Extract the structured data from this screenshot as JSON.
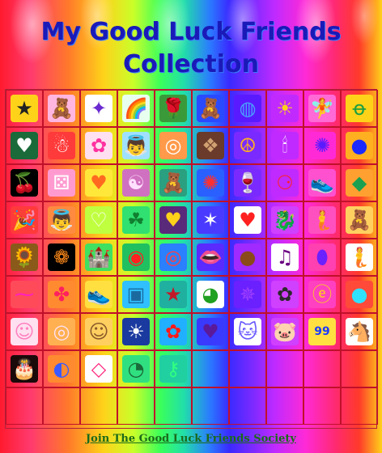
{
  "page": {
    "title": "My Good Luck Friends Collection",
    "footer_link": "Join The Good Luck Friends Society"
  },
  "colors": {
    "title": "#1a1ab8",
    "grid_border": "#c0102a",
    "footer_link": "#1a6a1a"
  },
  "grid": {
    "columns": 10,
    "rows": [
      [
        {
          "icon": "star-medal-icon",
          "glyph": "★",
          "bg": "#ffd21a",
          "fg": "#222"
        },
        {
          "icon": "pink-bear-icon",
          "glyph": "🧸",
          "bg": "#ffb6e0",
          "fg": "#c04090"
        },
        {
          "icon": "compass-icon",
          "glyph": "✦",
          "bg": "#ffffff",
          "fg": "#6a2ad0"
        },
        {
          "icon": "rainbow-icon",
          "glyph": "🌈",
          "bg": "#e8fff0",
          "fg": "#ff3030"
        },
        {
          "icon": "rose-icon",
          "glyph": "🌹",
          "bg": "#3a9a3a",
          "fg": "#ff2020"
        },
        {
          "icon": "teddy-bear-icon",
          "glyph": "🧸",
          "bg": "#2a4aff",
          "fg": "#c08020"
        },
        {
          "icon": "globe-icon",
          "glyph": "◍",
          "bg": "#5a1aff",
          "fg": "#4aa0ff"
        },
        {
          "icon": "sun-icon",
          "glyph": "☀",
          "bg": "#c02aff",
          "fg": "#ffd21a"
        },
        {
          "icon": "fairy-icon",
          "glyph": "🧚",
          "bg": "#ff6ad6",
          "fg": "#20a060"
        },
        {
          "icon": "ribbon-icon",
          "glyph": "ꝋ",
          "bg": "#ffd21a",
          "fg": "#20a040"
        }
      ],
      [
        {
          "icon": "heart-frame-icon",
          "glyph": "♥",
          "bg": "#1a6a3a",
          "fg": "#ffffff"
        },
        {
          "icon": "snowman-icon",
          "glyph": "☃",
          "bg": "#ff3a3a",
          "fg": "#ffffff"
        },
        {
          "icon": "troll-doll-icon",
          "glyph": "✿",
          "bg": "#ffe0f0",
          "fg": "#ff30a0"
        },
        {
          "icon": "angel-fairy-icon",
          "glyph": "👼",
          "bg": "#a0e0ff",
          "fg": "#ffb060"
        },
        {
          "icon": "dreamcatcher-icon",
          "glyph": "◎",
          "bg": "#ff9a4a",
          "fg": "#ffffff"
        },
        {
          "icon": "celtic-knot-icon",
          "glyph": "❖",
          "bg": "#6a3a2a",
          "fg": "#d0a070"
        },
        {
          "icon": "peace-sign-icon",
          "glyph": "☮",
          "bg": "#7a2aff",
          "fg": "#ffb020"
        },
        {
          "icon": "candle-icon",
          "glyph": "🕯",
          "bg": "#c02aff",
          "fg": "#ffffff"
        },
        {
          "icon": "purple-sun-icon",
          "glyph": "✺",
          "bg": "#ff2ad6",
          "fg": "#5a1aff"
        },
        {
          "icon": "blue-orb-icon",
          "glyph": "●",
          "bg": "#ffb020",
          "fg": "#1a2aff"
        }
      ],
      [
        {
          "icon": "cherries-icon",
          "glyph": "🍒",
          "bg": "#000000",
          "fg": "#ff2020"
        },
        {
          "icon": "dice-icon",
          "glyph": "⚄",
          "bg": "#ff9ad0",
          "fg": "#ffffff"
        },
        {
          "icon": "rainbow-heart-icon",
          "glyph": "♥",
          "bg": "#ffe83a",
          "fg": "#ff6a20"
        },
        {
          "icon": "yin-yang-icon",
          "glyph": "☯",
          "bg": "#d070c0",
          "fg": "#ffe0ff"
        },
        {
          "icon": "brown-bear-icon",
          "glyph": "🧸",
          "bg": "#2aa080",
          "fg": "#8a5a2a"
        },
        {
          "icon": "swirl-icon",
          "glyph": "✺",
          "bg": "#2a60ff",
          "fg": "#ff3030"
        },
        {
          "icon": "wine-glass-icon",
          "glyph": "🍷",
          "bg": "#7a2aff",
          "fg": "#ff2020"
        },
        {
          "icon": "gumball-machine-icon",
          "glyph": "⚆",
          "bg": "#c02aff",
          "fg": "#ff2020"
        },
        {
          "icon": "sneaker-icon",
          "glyph": "👟",
          "bg": "#ff50d0",
          "fg": "#ffffff"
        },
        {
          "icon": "green-gem-icon",
          "glyph": "◆",
          "bg": "#ffa030",
          "fg": "#1aa050"
        }
      ],
      [
        {
          "icon": "party-hat-icon",
          "glyph": "🎉",
          "bg": "#ff3a3a",
          "fg": "#ffd21a"
        },
        {
          "icon": "angel-icon",
          "glyph": "👼",
          "bg": "#ff8a40",
          "fg": "#8ac0ff"
        },
        {
          "icon": "outline-heart-icon",
          "glyph": "♡",
          "bg": "#c0ff40",
          "fg": "#ffffff"
        },
        {
          "icon": "four-leaf-clover-icon",
          "glyph": "☘",
          "bg": "#30e070",
          "fg": "#108030"
        },
        {
          "icon": "gold-heart-icon",
          "glyph": "♥",
          "bg": "#5a2a7a",
          "fg": "#ffd21a"
        },
        {
          "icon": "purple-swirl-icon",
          "glyph": "✶",
          "bg": "#4a3aff",
          "fg": "#ffffff"
        },
        {
          "icon": "dancing-heart-icon",
          "glyph": "♥",
          "bg": "#ffffff",
          "fg": "#ff2020"
        },
        {
          "icon": "bubble-dragon-icon",
          "glyph": "🐉",
          "bg": "#d040ff",
          "fg": "#40d040"
        },
        {
          "icon": "mermaid-icon",
          "glyph": "🧜",
          "bg": "#ff50c0",
          "fg": "#ffb040"
        },
        {
          "icon": "cream-bear-icon",
          "glyph": "🧸",
          "bg": "#ffd060",
          "fg": "#fff0c0"
        }
      ],
      [
        {
          "icon": "sunflowers-icon",
          "glyph": "🌻",
          "bg": "#8a5a1a",
          "fg": "#ffd21a"
        },
        {
          "icon": "orange-sunflower-icon",
          "glyph": "❁",
          "bg": "#000000",
          "fg": "#ff8a1a"
        },
        {
          "icon": "castle-icon",
          "glyph": "🏰",
          "bg": "#40e060",
          "fg": "#ffffff"
        },
        {
          "icon": "red-button-icon",
          "glyph": "◉",
          "bg": "#20c060",
          "fg": "#ff2020"
        },
        {
          "icon": "blue-dreamcatcher-icon",
          "glyph": "◎",
          "bg": "#2a80ff",
          "fg": "#ff4040"
        },
        {
          "icon": "lips-icon",
          "glyph": "👄",
          "bg": "#5a2aff",
          "fg": "#ff2030"
        },
        {
          "icon": "cookie-icon",
          "glyph": "●",
          "bg": "#a02aff",
          "fg": "#8a4a1a"
        },
        {
          "icon": "music-note-icon",
          "glyph": "♫",
          "bg": "#ffffff",
          "fg": "#6a0080"
        },
        {
          "icon": "purple-egg-icon",
          "glyph": "⬮",
          "bg": "#ff40b0",
          "fg": "#6a20ff"
        },
        {
          "icon": "mermaid-blue-icon",
          "glyph": "🧜",
          "bg": "#ffffff",
          "fg": "#30a0ff"
        }
      ],
      [
        {
          "icon": "pink-butterfly-icon",
          "glyph": "⁓",
          "bg": "#ff4a5a",
          "fg": "#ff20c0"
        },
        {
          "icon": "pink-pinwheel-icon",
          "glyph": "✤",
          "bg": "#ff8a30",
          "fg": "#ff2060"
        },
        {
          "icon": "pink-sneaker-icon",
          "glyph": "👟",
          "bg": "#ffe040",
          "fg": "#ff70c0"
        },
        {
          "icon": "teal-square-icon",
          "glyph": "▣",
          "bg": "#30c0ff",
          "fg": "#1a6aa0"
        },
        {
          "icon": "star-badge-icon",
          "glyph": "★",
          "bg": "#20b0a0",
          "fg": "#c01a2a"
        },
        {
          "icon": "bug-eyes-icon",
          "glyph": "◕",
          "bg": "#ffffff",
          "fg": "#20a020"
        },
        {
          "icon": "celtic-circle-icon",
          "glyph": "✵",
          "bg": "#6a20ff",
          "fg": "#a040ff"
        },
        {
          "icon": "flower-pot-icon",
          "glyph": "✿",
          "bg": "#d040ff",
          "fg": "#2a2a2a"
        },
        {
          "icon": "initial-coin-icon",
          "glyph": "ⓔ",
          "bg": "#ff40c0",
          "fg": "#ffd21a"
        },
        {
          "icon": "cyan-circle-icon",
          "glyph": "●",
          "bg": "#ff4a3a",
          "fg": "#30e0ff"
        }
      ],
      [
        {
          "icon": "baby-doll-icon",
          "glyph": "☺",
          "bg": "#ffe0f0",
          "fg": "#ff80c0"
        },
        {
          "icon": "pastel-ball-icon",
          "glyph": "◎",
          "bg": "#ffb050",
          "fg": "#ffe0f0"
        },
        {
          "icon": "girl-portrait-icon",
          "glyph": "☺",
          "bg": "#ffd060",
          "fg": "#8a5a2a"
        },
        {
          "icon": "blue-sun-badge-icon",
          "glyph": "☀",
          "bg": "#1a3aa0",
          "fg": "#ffffff"
        },
        {
          "icon": "red-flower-icon",
          "glyph": "✿",
          "bg": "#20b0ff",
          "fg": "#ff1a1a"
        },
        {
          "icon": "small-heart-icon",
          "glyph": "♥",
          "bg": "#3a3aff",
          "fg": "#5a1a9a"
        },
        {
          "icon": "blue-cat-icon",
          "glyph": "🐱",
          "bg": "#ffffff",
          "fg": "#6a5aff"
        },
        {
          "icon": "pink-pig-icon",
          "glyph": "🐷",
          "bg": "#d040ff",
          "fg": "#ff9ab0"
        },
        {
          "icon": "number-card-icon",
          "glyph": "99",
          "bg": "#ffe040",
          "fg": "#1a3aff"
        },
        {
          "icon": "horse-icon",
          "glyph": "🐴",
          "bg": "#ffffff",
          "fg": "#c08030"
        }
      ],
      [
        {
          "icon": "birthday-cake-icon",
          "glyph": "🎂",
          "bg": "#1a0a0a",
          "fg": "#ff6a20"
        },
        {
          "icon": "blue-moon-orb-icon",
          "glyph": "◐",
          "bg": "#ff8a30",
          "fg": "#3a5aff"
        },
        {
          "icon": "kite-icon",
          "glyph": "◇",
          "bg": "#ffffff",
          "fg": "#ff2a80"
        },
        {
          "icon": "green-orb-icon",
          "glyph": "◔",
          "bg": "#30e080",
          "fg": "#1a6a3a"
        },
        {
          "icon": "green-key-icon",
          "glyph": "⚷",
          "bg": "#20d0a0",
          "fg": "#30ff80"
        },
        {
          "icon": "empty",
          "glyph": "",
          "bg": "transparent",
          "fg": "#000"
        },
        {
          "icon": "empty",
          "glyph": "",
          "bg": "transparent",
          "fg": "#000"
        },
        {
          "icon": "empty",
          "glyph": "",
          "bg": "transparent",
          "fg": "#000"
        },
        {
          "icon": "empty",
          "glyph": "",
          "bg": "transparent",
          "fg": "#000"
        },
        {
          "icon": "empty",
          "glyph": "",
          "bg": "transparent",
          "fg": "#000"
        }
      ],
      [
        {
          "icon": "empty",
          "glyph": "",
          "bg": "transparent",
          "fg": "#000"
        },
        {
          "icon": "empty",
          "glyph": "",
          "bg": "transparent",
          "fg": "#000"
        },
        {
          "icon": "empty",
          "glyph": "",
          "bg": "transparent",
          "fg": "#000"
        },
        {
          "icon": "empty",
          "glyph": "",
          "bg": "transparent",
          "fg": "#000"
        },
        {
          "icon": "empty",
          "glyph": "",
          "bg": "transparent",
          "fg": "#000"
        },
        {
          "icon": "empty",
          "glyph": "",
          "bg": "transparent",
          "fg": "#000"
        },
        {
          "icon": "empty",
          "glyph": "",
          "bg": "transparent",
          "fg": "#000"
        },
        {
          "icon": "empty",
          "glyph": "",
          "bg": "transparent",
          "fg": "#000"
        },
        {
          "icon": "empty",
          "glyph": "",
          "bg": "transparent",
          "fg": "#000"
        },
        {
          "icon": "empty",
          "glyph": "",
          "bg": "transparent",
          "fg": "#000"
        }
      ]
    ]
  }
}
